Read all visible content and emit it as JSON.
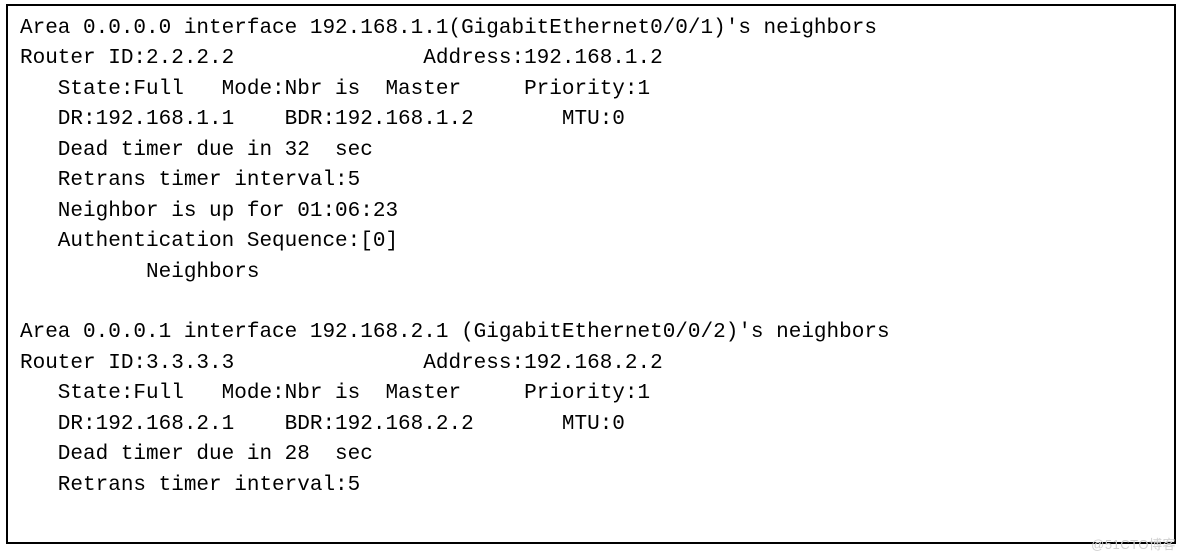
{
  "watermark": "@51CTO博客",
  "neighbors": [
    {
      "area": "0.0.0.0",
      "interface_ip": "192.168.1.1",
      "interface_name": "GigabitEthernet0/0/1",
      "router_id": "2.2.2.2",
      "address": "192.168.1.2",
      "state": "Full",
      "mode": "Nbr is  Master",
      "priority": "1",
      "dr": "192.168.1.1",
      "bdr": "192.168.1.2",
      "mtu": "0",
      "dead_timer": "32",
      "retrans_interval": "5",
      "uptime": "01:06:23",
      "auth_seq": "[0]",
      "header_line": "Area 0.0.0.0 interface 192.168.1.1(GigabitEthernet0/0/1)'s neighbors",
      "body_lines": [
        "Router ID:2.2.2.2               Address:192.168.1.2",
        "   State:Full   Mode:Nbr is  Master     Priority:1",
        "   DR:192.168.1.1    BDR:192.168.1.2       MTU:0",
        "   Dead timer due in 32  sec",
        "   Retrans timer interval:5",
        "   Neighbor is up for 01:06:23",
        "   Authentication Sequence:[0]",
        "          Neighbors"
      ]
    },
    {
      "area": "0.0.0.1",
      "interface_ip": "192.168.2.1",
      "interface_name": "GigabitEthernet0/0/2",
      "router_id": "3.3.3.3",
      "address": "192.168.2.2",
      "state": "Full",
      "mode": "Nbr is  Master",
      "priority": "1",
      "dr": "192.168.2.1",
      "bdr": "192.168.2.2",
      "mtu": "0",
      "dead_timer": "28",
      "retrans_interval": "5",
      "header_line": "Area 0.0.0.1 interface 192.168.2.1 (GigabitEthernet0/0/2)'s neighbors",
      "body_lines": [
        "Router ID:3.3.3.3               Address:192.168.2.2",
        "   State:Full   Mode:Nbr is  Master     Priority:1",
        "   DR:192.168.2.1    BDR:192.168.2.2       MTU:0",
        "   Dead timer due in 28  sec",
        "   Retrans timer interval:5"
      ]
    }
  ]
}
